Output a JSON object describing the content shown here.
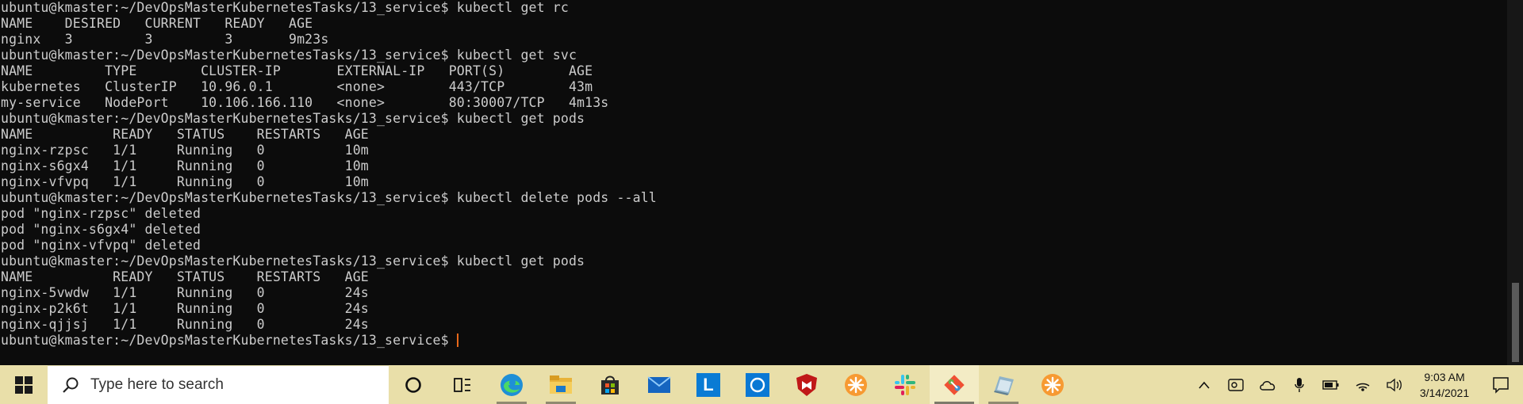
{
  "terminal": {
    "prompt": "ubuntu@kmaster:~/DevOpsMasterKubernetesTasks/13_service$",
    "lines": [
      "ubuntu@kmaster:~/DevOpsMasterKubernetesTasks/13_service$ kubectl get rc",
      "NAME    DESIRED   CURRENT   READY   AGE",
      "nginx   3         3         3       9m23s",
      "ubuntu@kmaster:~/DevOpsMasterKubernetesTasks/13_service$ kubectl get svc",
      "NAME         TYPE        CLUSTER-IP       EXTERNAL-IP   PORT(S)        AGE",
      "kubernetes   ClusterIP   10.96.0.1        <none>        443/TCP        43m",
      "my-service   NodePort    10.106.166.110   <none>        80:30007/TCP   4m13s",
      "ubuntu@kmaster:~/DevOpsMasterKubernetesTasks/13_service$ kubectl get pods",
      "NAME          READY   STATUS    RESTARTS   AGE",
      "nginx-rzpsc   1/1     Running   0          10m",
      "nginx-s6gx4   1/1     Running   0          10m",
      "nginx-vfvpq   1/1     Running   0          10m",
      "ubuntu@kmaster:~/DevOpsMasterKubernetesTasks/13_service$ kubectl delete pods --all",
      "pod \"nginx-rzpsc\" deleted",
      "pod \"nginx-s6gx4\" deleted",
      "pod \"nginx-vfvpq\" deleted",
      "ubuntu@kmaster:~/DevOpsMasterKubernetesTasks/13_service$ kubectl get pods",
      "NAME          READY   STATUS    RESTARTS   AGE",
      "nginx-5vwdw   1/1     Running   0          24s",
      "nginx-p2k6t   1/1     Running   0          24s",
      "nginx-qjjsj   1/1     Running   0          24s"
    ]
  },
  "taskbar": {
    "search_placeholder": "Type here to search",
    "pinned": [
      {
        "name": "cortana-icon",
        "icon": "circle"
      },
      {
        "name": "task-view-icon",
        "icon": "task-view"
      },
      {
        "name": "edge-icon",
        "icon": "edge"
      },
      {
        "name": "file-explorer-icon",
        "icon": "folder"
      },
      {
        "name": "microsoft-store-icon",
        "icon": "store"
      },
      {
        "name": "mail-icon",
        "icon": "mail"
      },
      {
        "name": "l-app-icon",
        "icon": "L",
        "label": "L"
      },
      {
        "name": "blue-app-icon",
        "icon": "blue-square"
      },
      {
        "name": "mcafee-icon",
        "icon": "shield"
      },
      {
        "name": "orange-app-icon",
        "icon": "orange-flower"
      },
      {
        "name": "slack-icon",
        "icon": "slack"
      },
      {
        "name": "git-icon",
        "icon": "git"
      },
      {
        "name": "terminal-icon",
        "icon": "terminal"
      },
      {
        "name": "orange-app-2-icon",
        "icon": "orange-flower"
      }
    ],
    "clock": {
      "time": "9:03 AM",
      "date": "3/14/2021"
    }
  },
  "colors": {
    "terminal_bg": "#0c0c0c",
    "terminal_text": "#cccccc",
    "cursor": "#e8681a",
    "taskbar_bg": "#e9dfa9"
  }
}
